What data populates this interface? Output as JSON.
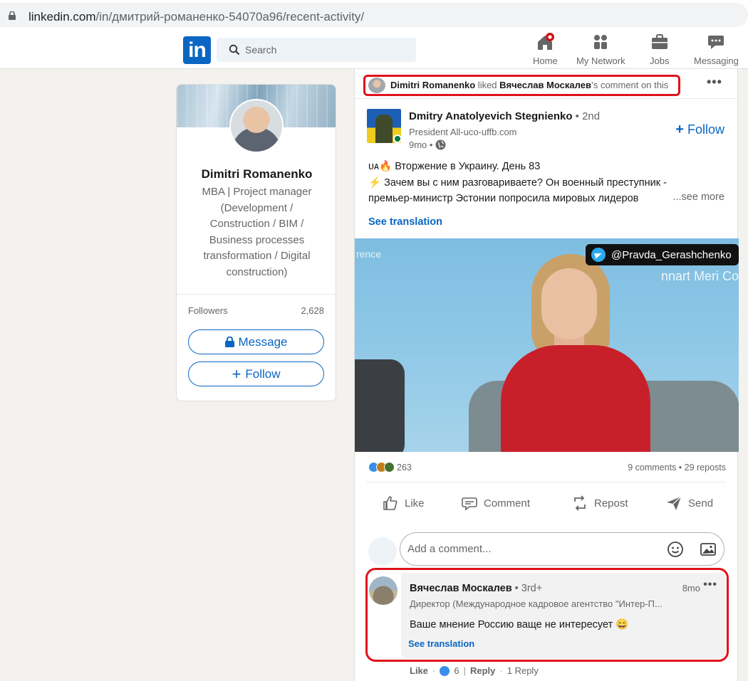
{
  "browser": {
    "url_host": "linkedin.com",
    "url_path": "/in/дмитрий-романенко-54070a96/recent-activity/"
  },
  "nav": {
    "logo_text": "in",
    "search_placeholder": "Search",
    "items": [
      {
        "label": "Home",
        "icon": "home-icon"
      },
      {
        "label": "My Network",
        "icon": "people-icon"
      },
      {
        "label": "Jobs",
        "icon": "briefcase-icon"
      },
      {
        "label": "Messaging",
        "icon": "chat-icon"
      }
    ]
  },
  "profile": {
    "name": "Dimitri Romanenko",
    "headline": "MBA | Project manager (Development / Construction / BIM / Business processes transformation / Digital construction)",
    "followers_label": "Followers",
    "followers_count": "2,628",
    "message_label": "Message",
    "follow_label": "Follow"
  },
  "activity": {
    "actor": "Dimitri Romanenko",
    "verb": " liked ",
    "target": "Вячеслав Москалев",
    "suffix": "’s comment on this"
  },
  "post": {
    "author_name": "Dmitry Anatolyevich Stegnienko",
    "author_degree": " • 2nd",
    "author_title": "President All-uco-uffb.com",
    "author_time": "9mo •",
    "follow_label": "Follow",
    "text_line1": "ᴜᴀ🔥 Вторжение в Украину. День 83",
    "text_line2": "⚡ Зачем вы с ним разговариваете? Он военный преступник -",
    "text_line3": "премьер-министр Эстонии попросила мировых лидеров",
    "see_more": "...see more",
    "see_translation": "See translation",
    "video_channel": "@Pravda_Gerashchenko",
    "video_backdrop": "nnart Meri Conference",
    "video_backdrop_left": "rence",
    "reaction_count": "263",
    "comments_reposts": "9 comments • 29 reposts"
  },
  "actions": {
    "like": "Like",
    "comment": "Comment",
    "repost": "Repost",
    "send": "Send"
  },
  "comment_box": {
    "placeholder": "Add a comment..."
  },
  "comment": {
    "author_name": "Вячеслав Москалев",
    "author_degree": " • 3rd+",
    "time": "8mo",
    "headline": "Директор (Международное кадровое агентство \"Интер-П...",
    "text": "Ваше мнение Россию ваще не интересует 😄",
    "see_translation": "See translation",
    "like_label": "Like",
    "like_count": "6",
    "reply_label": "Reply",
    "replies": "1 Reply"
  },
  "colors": {
    "linkedin_blue": "#0a66c2",
    "highlight_red": "#e0121b",
    "notification_red": "#cc1016"
  }
}
